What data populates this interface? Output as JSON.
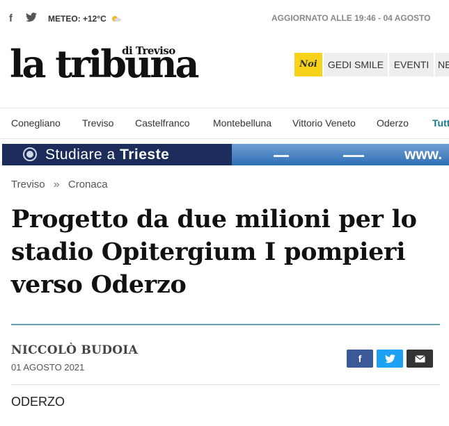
{
  "topbar": {
    "facebook_icon": "facebook-icon",
    "twitter_icon": "twitter-icon",
    "meteo": "METEO: +12°C",
    "weather_icon": "sun-cloud-icon",
    "updated": "AGGIORNATO ALLE 19:46 - 04 AGOSTO"
  },
  "logo": {
    "main": "la tribuna",
    "sub": "di Treviso"
  },
  "top_nav": [
    "Noi",
    "GEDI SMILE",
    "EVENTI",
    "NE"
  ],
  "cities": [
    "Conegliano",
    "Treviso",
    "Castelfranco",
    "Montebelluna",
    "Vittorio Veneto",
    "Oderzo",
    "Tutt"
  ],
  "banner": {
    "text_normal": "Studiare a ",
    "text_bold": "Trieste",
    "url": "www."
  },
  "breadcrumb": {
    "section": "Treviso",
    "separator": "»",
    "subsection": "Cronaca"
  },
  "article": {
    "title": "Progetto da due milioni per lo stadio Opitergium I pompieri verso Oderzo",
    "author": "NICCOLÒ BUDOIA",
    "date": "01 AGOSTO 2021",
    "location": "ODERZO"
  },
  "share": {
    "facebook": "f",
    "twitter": "twitter-bird",
    "email": "envelope-icon"
  },
  "colors": {
    "noi_bg": "#f7d21a",
    "banner_left": "#1d2d5b",
    "rule": "#6b9fae",
    "fb": "#3b5998",
    "tw": "#1da1f2",
    "tutt": "#1a7a8a"
  }
}
